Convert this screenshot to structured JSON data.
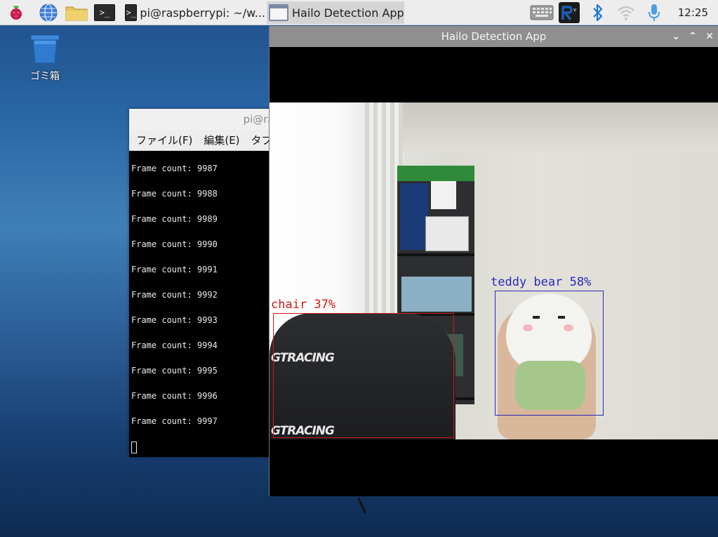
{
  "taskbar": {
    "tasks": [
      {
        "label": "pi@raspberrypi: ~/w..."
      },
      {
        "label": "Hailo Detection App"
      }
    ],
    "clock": "12:25",
    "terminal_glyph": ">_"
  },
  "desktop": {
    "trash_label": "ゴミ箱"
  },
  "terminal": {
    "title": "pi@rasp",
    "menu": [
      "ファイル(F)",
      "編集(E)",
      "タブ"
    ],
    "lines": [
      "Frame count: 9987",
      "Frame count: 9988",
      "Frame count: 9989",
      "Frame count: 9990",
      "Frame count: 9991",
      "Frame count: 9992",
      "Frame count: 9993",
      "Frame count: 9994",
      "Frame count: 9995",
      "Frame count: 9996",
      "Frame count: 9997"
    ]
  },
  "hailo": {
    "title": "Hailo Detection App",
    "detections": [
      {
        "label": "chair 37%",
        "color": "#d01818"
      },
      {
        "label": "teddy bear 58%",
        "color": "#2a2ab8"
      }
    ],
    "chair_brand": "GTRACING"
  },
  "colors": {
    "bluetooth": "#1f73d8",
    "vnc": "#1c5fb0"
  }
}
